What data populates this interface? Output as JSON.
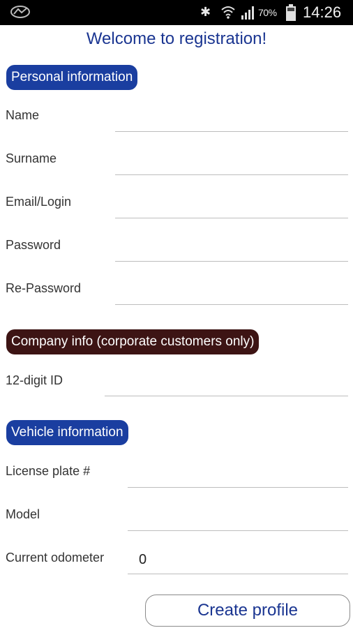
{
  "status_bar": {
    "battery_percent": "70%",
    "time": "14:26",
    "icons": [
      "app-notification-icon",
      "bluetooth-icon",
      "wifi-icon",
      "signal-icon",
      "battery-icon"
    ]
  },
  "page": {
    "title": "Welcome to registration!"
  },
  "sections": {
    "personal": {
      "label": "Personal information",
      "color": "#1a3ea0",
      "fields": {
        "name": {
          "label": "Name",
          "value": ""
        },
        "surname": {
          "label": "Surname",
          "value": ""
        },
        "email": {
          "label": "Email/Login",
          "value": ""
        },
        "password": {
          "label": "Password",
          "value": ""
        },
        "repassword": {
          "label": "Re-Password",
          "value": ""
        }
      }
    },
    "company": {
      "label": "Company info (corporate customers only)",
      "color": "#3d1414",
      "fields": {
        "id12": {
          "label": "12-digit ID",
          "value": ""
        }
      }
    },
    "vehicle": {
      "label": "Vehicle information",
      "color": "#1a3ea0",
      "fields": {
        "plate": {
          "label": "License plate #",
          "value": ""
        },
        "model": {
          "label": "Model",
          "value": ""
        },
        "odometer": {
          "label": "Current odometer",
          "value": "0"
        }
      }
    }
  },
  "actions": {
    "create_profile_label": "Create profile"
  }
}
